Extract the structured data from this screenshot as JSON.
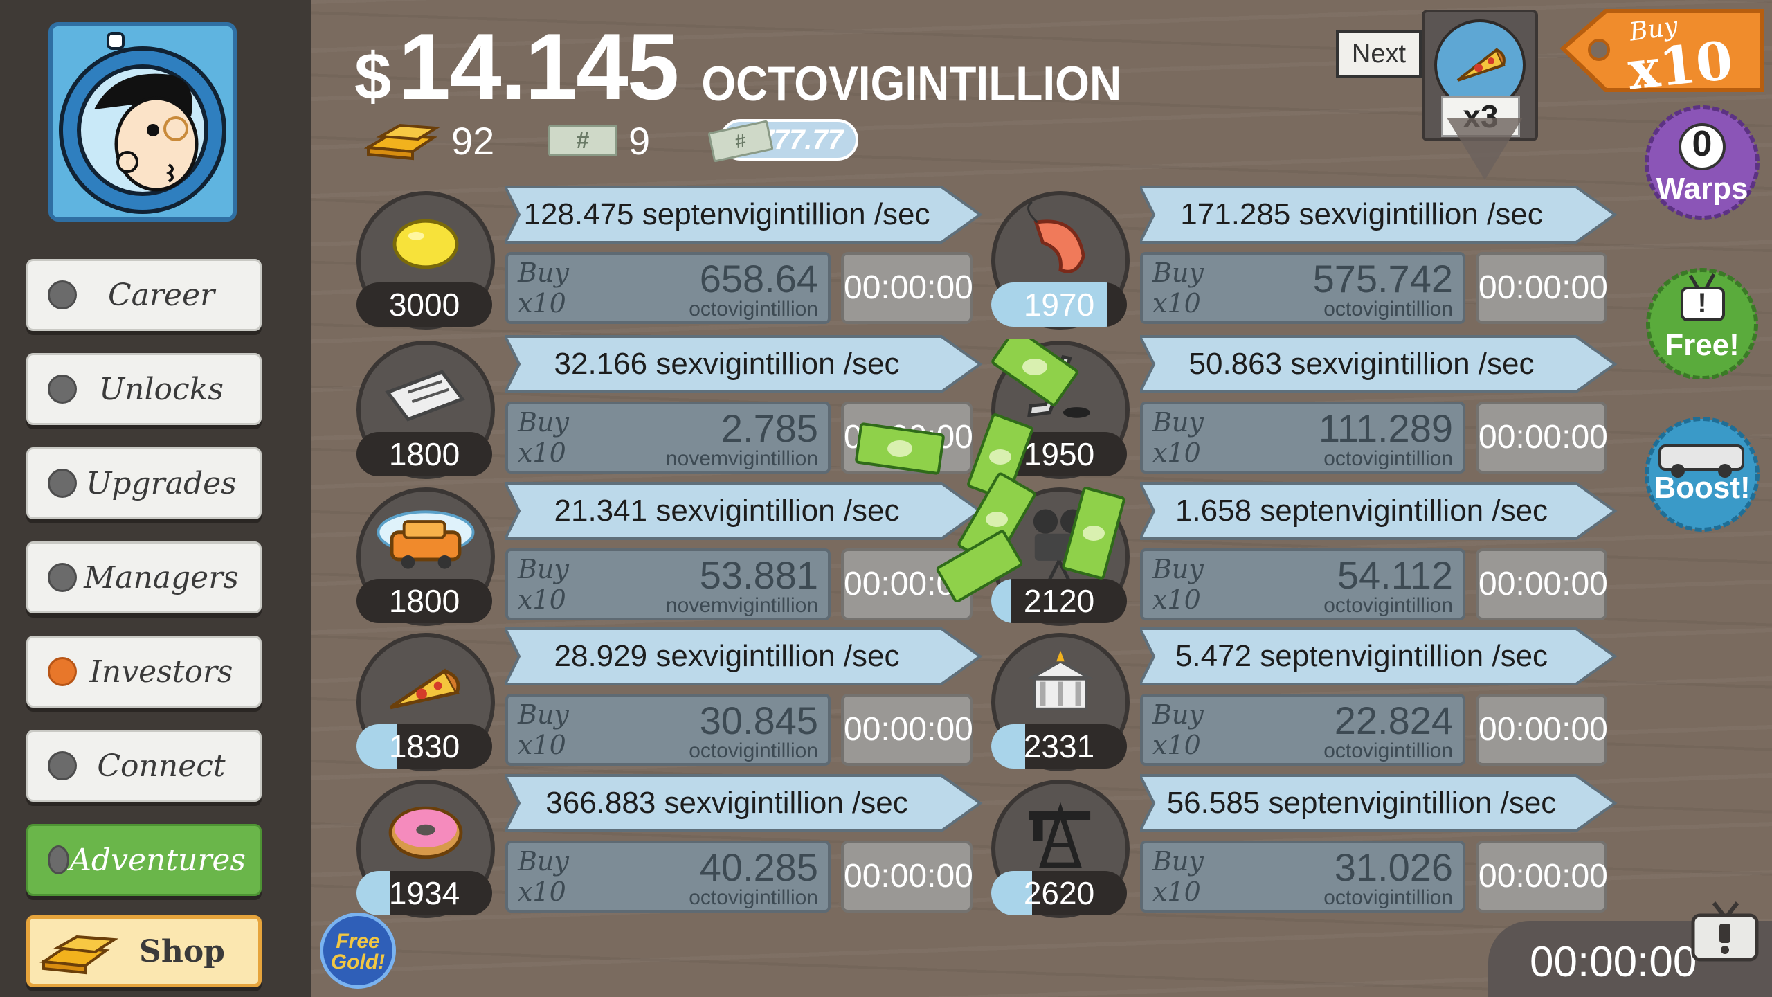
{
  "header": {
    "currency_symbol": "$",
    "money_value": "14.145",
    "money_unit": "OCTOVIGINTILLION",
    "gold_count": "92",
    "megabucks_count": "9",
    "multiplier_pill": "x777.77",
    "ticket_symbol": "#"
  },
  "sidebar": {
    "items": [
      {
        "label": "Career",
        "dot": "gray"
      },
      {
        "label": "Unlocks",
        "dot": "gray"
      },
      {
        "label": "Upgrades",
        "dot": "gray"
      },
      {
        "label": "Managers",
        "dot": "gray"
      },
      {
        "label": "Investors",
        "dot": "orange"
      },
      {
        "label": "Connect",
        "dot": "gray"
      },
      {
        "label": "Adventures",
        "dot": "gray"
      },
      {
        "label": "Shop",
        "dot": "none"
      }
    ]
  },
  "businesses": [
    {
      "icon": "lemon-icon",
      "count": "3000",
      "count_progress": 0.0,
      "rate": "128.475 septenvigintillion /sec",
      "buy_line1": "Buy",
      "buy_line2": "x10",
      "cost": "658.64",
      "cost_unit": "octovigintillion",
      "timer": "00:00:00"
    },
    {
      "icon": "shrimp-icon",
      "count": "1970",
      "count_progress": 0.85,
      "rate": "171.285 sexvigintillion /sec",
      "buy_line1": "Buy",
      "buy_line2": "x10",
      "cost": "575.742",
      "cost_unit": "octovigintillion",
      "timer": "00:00:00"
    },
    {
      "icon": "newspaper-icon",
      "count": "1800",
      "count_progress": 0.0,
      "rate": "32.166 sexvigintillion /sec",
      "buy_line1": "Buy",
      "buy_line2": "x10",
      "cost": "2.785",
      "cost_unit": "novemvigintillion",
      "timer": "00:00:00"
    },
    {
      "icon": "hockey-icon",
      "count": "1950",
      "count_progress": 0.0,
      "rate": "50.863 sexvigintillion /sec",
      "buy_line1": "Buy",
      "buy_line2": "x10",
      "cost": "111.289",
      "cost_unit": "octovigintillion",
      "timer": "00:00:00"
    },
    {
      "icon": "car-icon",
      "count": "1800",
      "count_progress": 0.0,
      "rate": "21.341 sexvigintillion /sec",
      "buy_line1": "Buy",
      "buy_line2": "x10",
      "cost": "53.881",
      "cost_unit": "novemvigintillion",
      "timer": "00:00:00"
    },
    {
      "icon": "movie-camera-icon",
      "count": "2120",
      "count_progress": 0.15,
      "rate": "1.658 septenvigintillion /sec",
      "buy_line1": "Buy",
      "buy_line2": "x10",
      "cost": "54.112",
      "cost_unit": "octovigintillion",
      "timer": "00:00:00"
    },
    {
      "icon": "pizza-icon",
      "count": "1830",
      "count_progress": 0.3,
      "rate": "28.929 sexvigintillion /sec",
      "buy_line1": "Buy",
      "buy_line2": "x10",
      "cost": "30.845",
      "cost_unit": "octovigintillion",
      "timer": "00:00:00"
    },
    {
      "icon": "bank-icon",
      "count": "2331",
      "count_progress": 0.25,
      "rate": "5.472 septenvigintillion /sec",
      "buy_line1": "Buy",
      "buy_line2": "x10",
      "cost": "22.824",
      "cost_unit": "octovigintillion",
      "timer": "00:00:00"
    },
    {
      "icon": "donut-icon",
      "count": "1934",
      "count_progress": 0.25,
      "rate": "366.883 sexvigintillion /sec",
      "buy_line1": "Buy",
      "buy_line2": "x10",
      "cost": "40.285",
      "cost_unit": "octovigintillion",
      "timer": "00:00:00"
    },
    {
      "icon": "oil-rig-icon",
      "count": "2620",
      "count_progress": 0.3,
      "rate": "56.585 septenvigintillion /sec",
      "buy_line1": "Buy",
      "buy_line2": "x10",
      "cost": "31.026",
      "cost_unit": "octovigintillion",
      "timer": "00:00:00"
    }
  ],
  "right": {
    "next_label": "Next",
    "next_multiplier": "x3",
    "buy_tag_line1": "Buy",
    "buy_tag_line2": "x10",
    "warps_count": "0",
    "warps_label": "Warps",
    "free_symbol": "!",
    "free_label": "Free!",
    "boost_label": "Boost!",
    "free_gold_line1": "Free",
    "free_gold_line2": "Gold!",
    "bottom_timer": "00:00:00"
  },
  "colors": {
    "background": "#7a6b5f",
    "sidebar": "#3f3a36",
    "rate_bar": "#b9d6e8",
    "buy_button": "#7d8c96",
    "adventures_green": "#6ab64a",
    "investor_dot": "#e8772a"
  }
}
